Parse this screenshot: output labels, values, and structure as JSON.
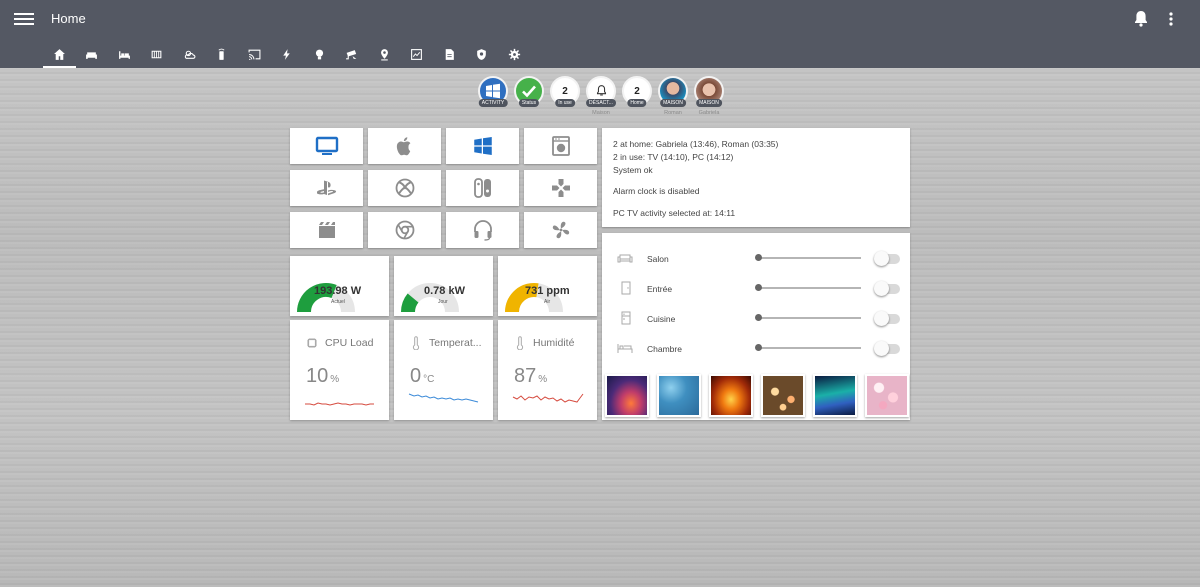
{
  "app": {
    "title": "Home"
  },
  "tabs": [
    {
      "name": "home-icon",
      "active": true
    },
    {
      "name": "sofa-icon"
    },
    {
      "name": "bed-icon"
    },
    {
      "name": "radiator-icon"
    },
    {
      "name": "weather-icon"
    },
    {
      "name": "remote-icon"
    },
    {
      "name": "cast-icon"
    },
    {
      "name": "flash-icon"
    },
    {
      "name": "lightbulb-icon"
    },
    {
      "name": "cctv-icon"
    },
    {
      "name": "map-marker-icon"
    },
    {
      "name": "chart-icon"
    },
    {
      "name": "file-icon"
    },
    {
      "name": "shield-icon"
    },
    {
      "name": "gear-icon"
    }
  ],
  "badges": [
    {
      "label": "ACTIVITY",
      "icon": "windows-icon",
      "bg": "#2f6fc0"
    },
    {
      "label": "Status",
      "icon": "check-icon",
      "bg": "#46b14a"
    },
    {
      "value": "2",
      "label": "In use"
    },
    {
      "label": "DÉSACT...",
      "icon": "bell-icon",
      "sub": "Maison"
    },
    {
      "value": "2",
      "label": "Home"
    },
    {
      "label": "MAISON",
      "sub": "Roman",
      "icon": "avatar-roman"
    },
    {
      "label": "MAISON",
      "sub": "Gabriela",
      "icon": "avatar-gabriela"
    }
  ],
  "activity_buttons": [
    {
      "icon": "monitor-icon",
      "color": "#1f6fc6"
    },
    {
      "icon": "apple-icon",
      "color": "#888"
    },
    {
      "icon": "windows-icon",
      "color": "#1f6fc6"
    },
    {
      "icon": "washer-icon",
      "color": "#888"
    },
    {
      "icon": "playstation-icon",
      "color": "#888"
    },
    {
      "icon": "xbox-icon",
      "color": "#888"
    },
    {
      "icon": "nintendo-switch-icon",
      "color": "#888"
    },
    {
      "icon": "gamepad-icon",
      "color": "#888"
    },
    {
      "icon": "movie-icon",
      "color": "#888"
    },
    {
      "icon": "chrome-icon",
      "color": "#888"
    },
    {
      "icon": "headphones-icon",
      "color": "#888"
    },
    {
      "icon": "fan-icon",
      "color": "#888"
    }
  ],
  "gauges": [
    {
      "value": "193.98 W",
      "name": "Actuel",
      "fraction": 0.62,
      "color": "#1e9e3e"
    },
    {
      "value": "0.78 kW",
      "name": "Jour",
      "fraction": 0.22,
      "color": "#1e9e3e"
    },
    {
      "value": "731 ppm",
      "name": "Air",
      "fraction": 0.55,
      "color": "#f0b400"
    }
  ],
  "sensors": [
    {
      "name": "CPU Load",
      "value": "10",
      "unit": "%",
      "icon": "cpu-icon",
      "color": "#d64b3f"
    },
    {
      "name": "Temperat...",
      "value": "0",
      "unit": "°C",
      "icon": "thermometer-icon",
      "color": "#3b8ad8"
    },
    {
      "name": "Humidité",
      "value": "87",
      "unit": "%",
      "icon": "thermometer-icon",
      "color": "#d64b3f"
    }
  ],
  "info": {
    "lines": [
      "2 at home: Gabriela (13:46), Roman (03:35)",
      "2 in use: TV (14:10), PC (14:12)",
      "System ok",
      "Alarm clock is disabled",
      "PC TV activity selected at: 14:11"
    ]
  },
  "rooms": [
    {
      "name": "Salon",
      "icon": "sofa-icon",
      "level": 0,
      "on": false
    },
    {
      "name": "Entrée",
      "icon": "door-icon",
      "level": 0,
      "on": false
    },
    {
      "name": "Cuisine",
      "icon": "fridge-icon",
      "level": 0,
      "on": false
    },
    {
      "name": "Chambre",
      "icon": "bed-icon",
      "level": 0,
      "on": false
    }
  ],
  "scenes": [
    {
      "name": "sunset-palm-scene"
    },
    {
      "name": "water-scene"
    },
    {
      "name": "fire-scene"
    },
    {
      "name": "bokeh-scene"
    },
    {
      "name": "aurora-scene"
    },
    {
      "name": "cherry-blossom-scene"
    }
  ]
}
